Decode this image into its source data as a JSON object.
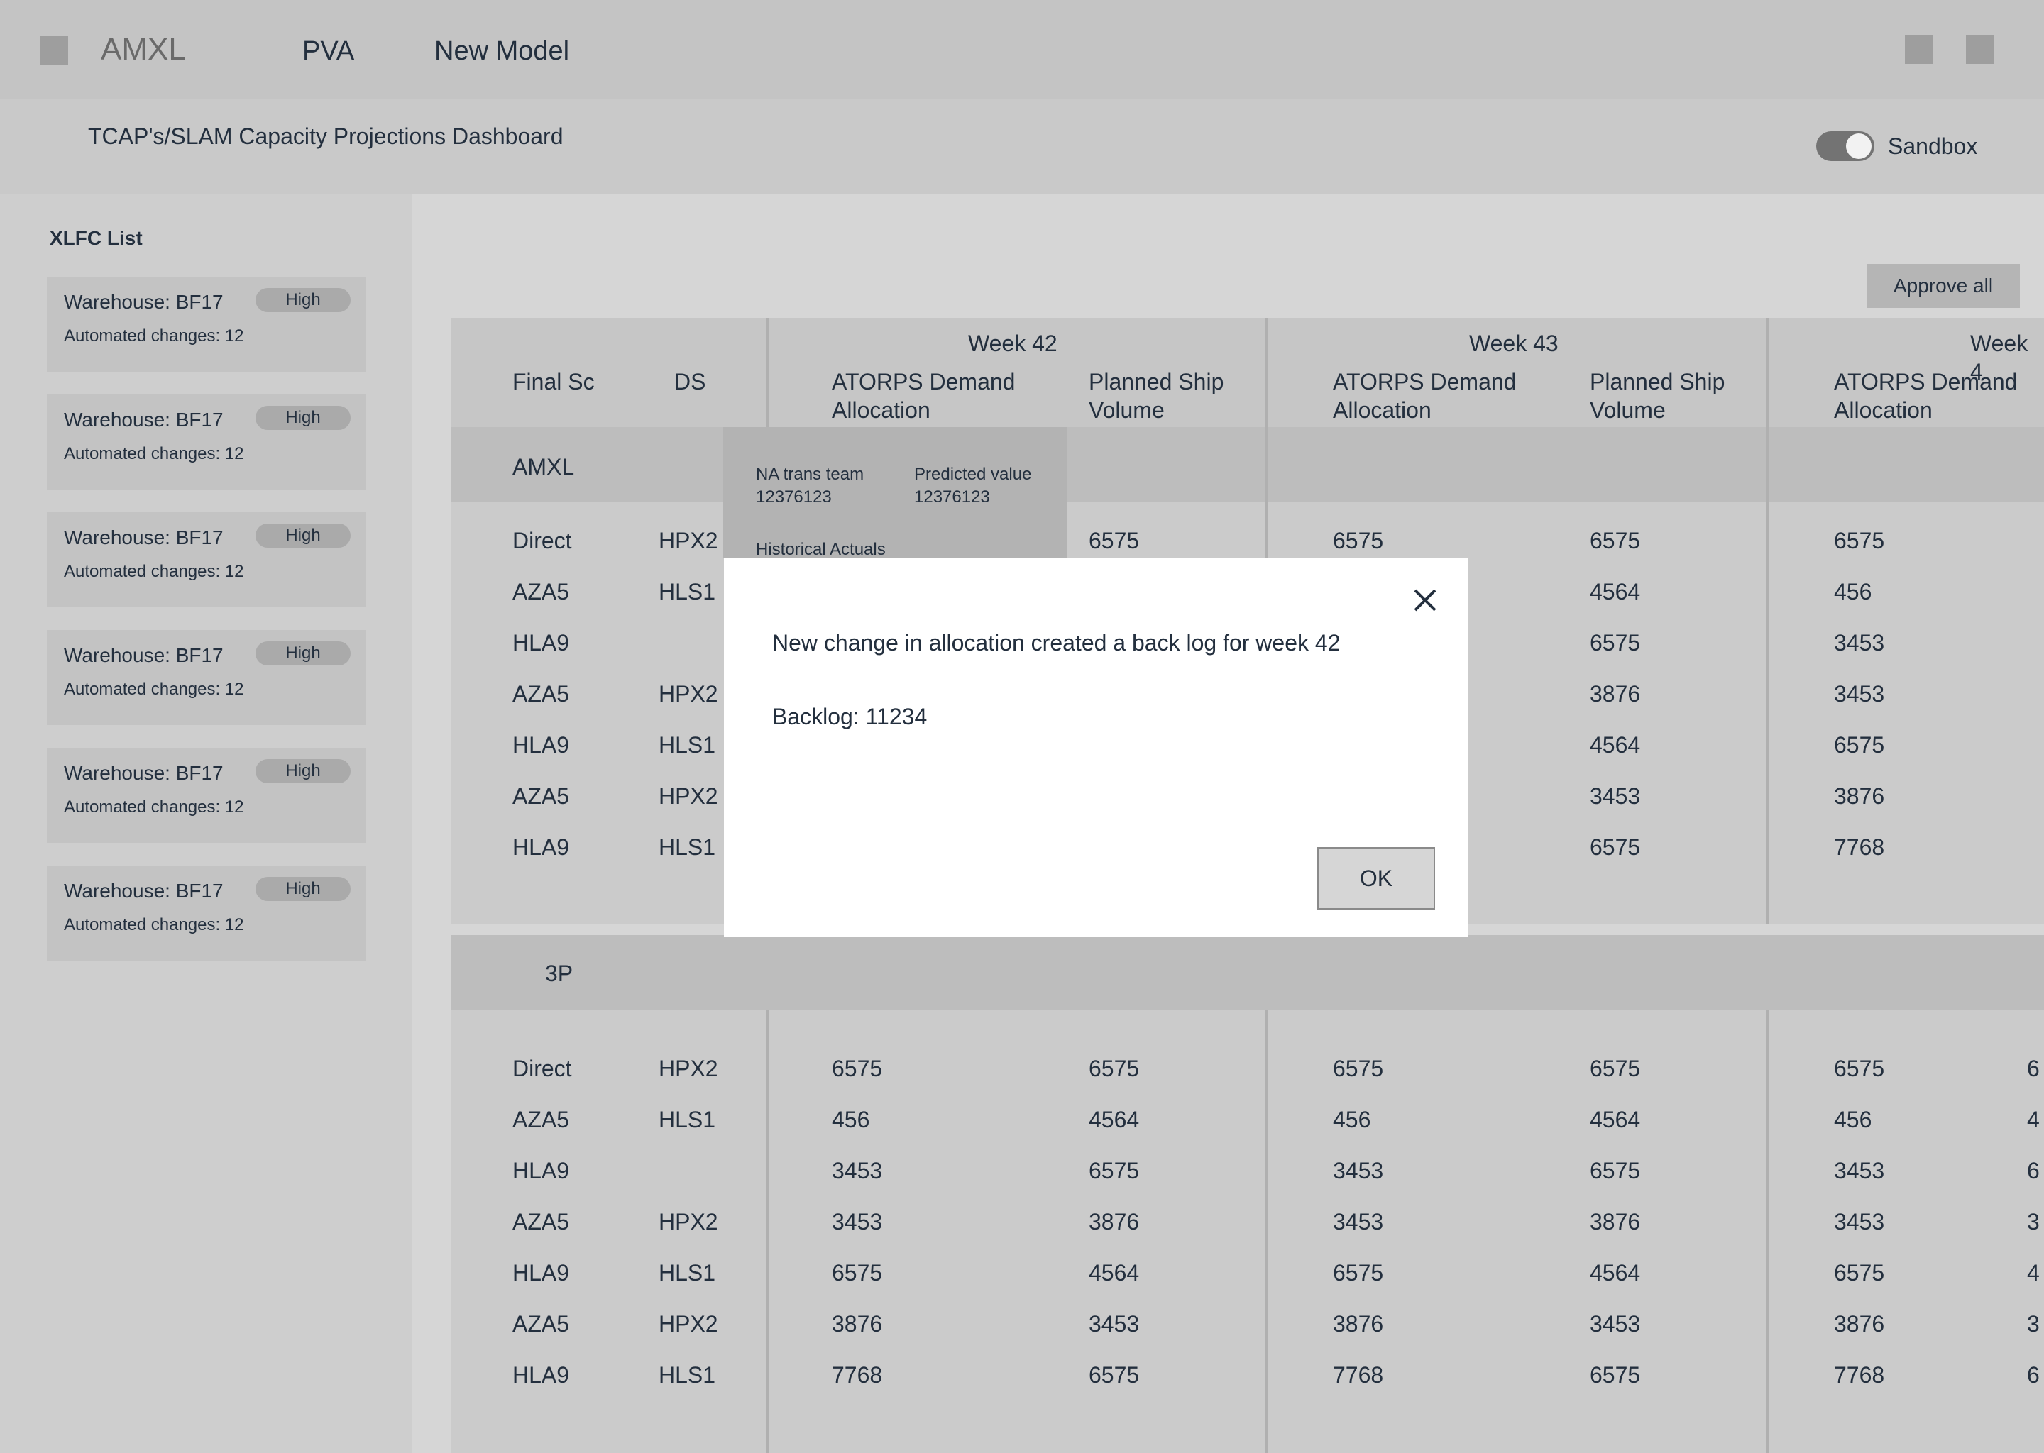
{
  "nav": {
    "brand": "AMXL",
    "links": [
      "PVA",
      "New Model"
    ]
  },
  "subheader": {
    "title": "TCAP's/SLAM Capacity Projections Dashboard",
    "sandbox_label": "Sandbox",
    "sandbox_on": true
  },
  "sidebar": {
    "title": "XLFC List",
    "cards": [
      {
        "warehouse": "Warehouse: BF17",
        "badge": "High",
        "changes": "Automated changes: 12"
      },
      {
        "warehouse": "Warehouse: BF17",
        "badge": "High",
        "changes": "Automated changes: 12"
      },
      {
        "warehouse": "Warehouse: BF17",
        "badge": "High",
        "changes": "Automated changes: 12"
      },
      {
        "warehouse": "Warehouse: BF17",
        "badge": "High",
        "changes": "Automated changes: 12"
      },
      {
        "warehouse": "Warehouse: BF17",
        "badge": "High",
        "changes": "Automated changes: 12"
      },
      {
        "warehouse": "Warehouse: BF17",
        "badge": "High",
        "changes": "Automated changes: 12"
      }
    ]
  },
  "main": {
    "approve_label": "Approve all",
    "col_final": "Final Sc",
    "col_ds": "DS",
    "weeks": [
      {
        "label": "Week 42",
        "col1": "ATORPS Demand Allocation",
        "col2": "Planned Ship Volume"
      },
      {
        "label": "Week 43",
        "col1": "ATORPS Demand Allocation",
        "col2": "Planned Ship Volume"
      },
      {
        "label": "Week 4",
        "col1": "ATORPS Demand Allocation",
        "col2": ""
      }
    ],
    "groups": [
      {
        "name": "AMXL",
        "rows": [
          {
            "final": "Direct",
            "ds": "HPX2",
            "v": [
              "",
              "6575",
              "6575",
              "6575",
              "6575",
              ""
            ]
          },
          {
            "final": "AZA5",
            "ds": "HLS1",
            "v": [
              "",
              "",
              "",
              "4564",
              "456",
              ""
            ]
          },
          {
            "final": "HLA9",
            "ds": "",
            "v": [
              "",
              "",
              "",
              "6575",
              "3453",
              ""
            ]
          },
          {
            "final": "AZA5",
            "ds": "HPX2",
            "v": [
              "",
              "",
              "",
              "3876",
              "3453",
              ""
            ]
          },
          {
            "final": "HLA9",
            "ds": "HLS1",
            "v": [
              "",
              "",
              "",
              "4564",
              "6575",
              ""
            ]
          },
          {
            "final": "AZA5",
            "ds": "HPX2",
            "v": [
              "",
              "",
              "",
              "3453",
              "3876",
              ""
            ]
          },
          {
            "final": "HLA9",
            "ds": "HLS1",
            "v": [
              "",
              "",
              "",
              "6575",
              "7768",
              ""
            ]
          }
        ]
      },
      {
        "name": "3P",
        "rows": [
          {
            "final": "Direct",
            "ds": "HPX2",
            "v": [
              "6575",
              "6575",
              "6575",
              "6575",
              "6575",
              "6"
            ]
          },
          {
            "final": "AZA5",
            "ds": "HLS1",
            "v": [
              "456",
              "4564",
              "456",
              "4564",
              "456",
              "4"
            ]
          },
          {
            "final": "HLA9",
            "ds": "",
            "v": [
              "3453",
              "6575",
              "3453",
              "6575",
              "3453",
              "6"
            ]
          },
          {
            "final": "AZA5",
            "ds": "HPX2",
            "v": [
              "3453",
              "3876",
              "3453",
              "3876",
              "3453",
              "3"
            ]
          },
          {
            "final": "HLA9",
            "ds": "HLS1",
            "v": [
              "6575",
              "4564",
              "6575",
              "4564",
              "6575",
              "4"
            ]
          },
          {
            "final": "AZA5",
            "ds": "HPX2",
            "v": [
              "3876",
              "3453",
              "3876",
              "3453",
              "3876",
              "3"
            ]
          },
          {
            "final": "HLA9",
            "ds": "HLS1",
            "v": [
              "7768",
              "6575",
              "7768",
              "6575",
              "7768",
              "6"
            ]
          }
        ]
      }
    ]
  },
  "tooltip": {
    "team_label": "NA trans team",
    "team_value": "12376123",
    "pred_label": "Predicted value",
    "pred_value": "12376123",
    "hist_label": "Historical Actuals"
  },
  "modal": {
    "message": "New change in allocation created a back log for week 42",
    "backlog": "Backlog: 11234",
    "ok_label": "OK",
    "close_icon": "close-icon"
  }
}
